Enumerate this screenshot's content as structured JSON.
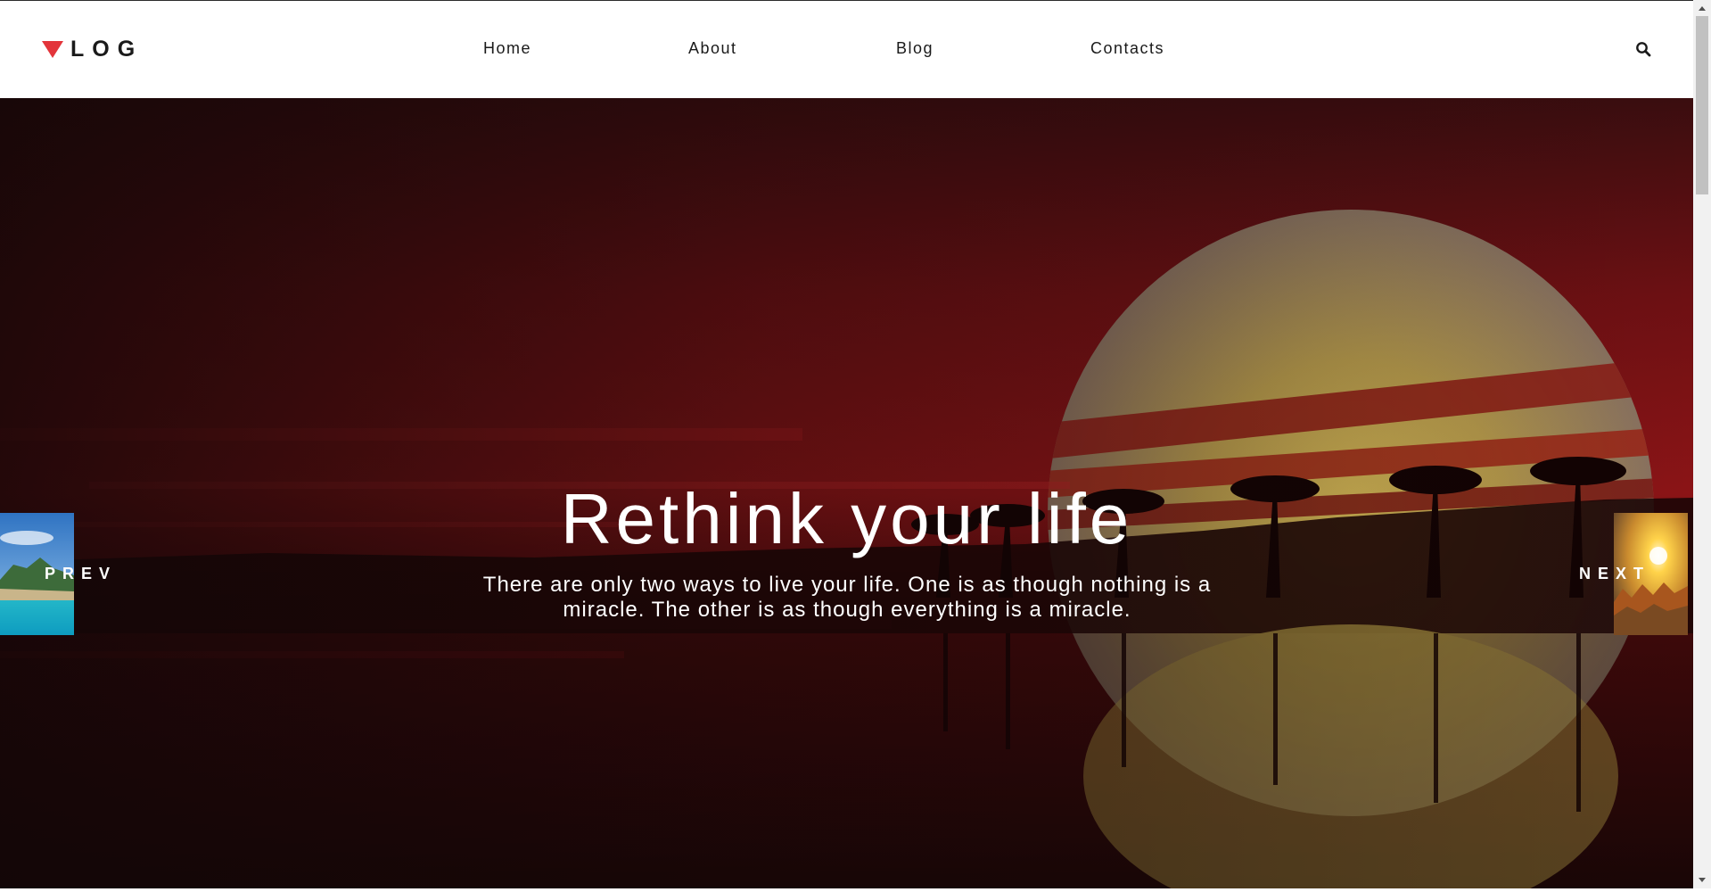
{
  "header": {
    "logo_text": "LOG",
    "logo_accent": "#e3353b",
    "nav": {
      "home": "Home",
      "about": "About",
      "blog": "Blog",
      "contacts": "Contacts"
    },
    "search_icon": "search-icon"
  },
  "hero": {
    "title": "Rethink your life",
    "text": "There are only two ways to live your life. One is as though nothing is a miracle. The other is as though everything is a miracle.",
    "prev_label": "PREV",
    "next_label": "NEXT",
    "overlay_color": "#8b1416"
  }
}
